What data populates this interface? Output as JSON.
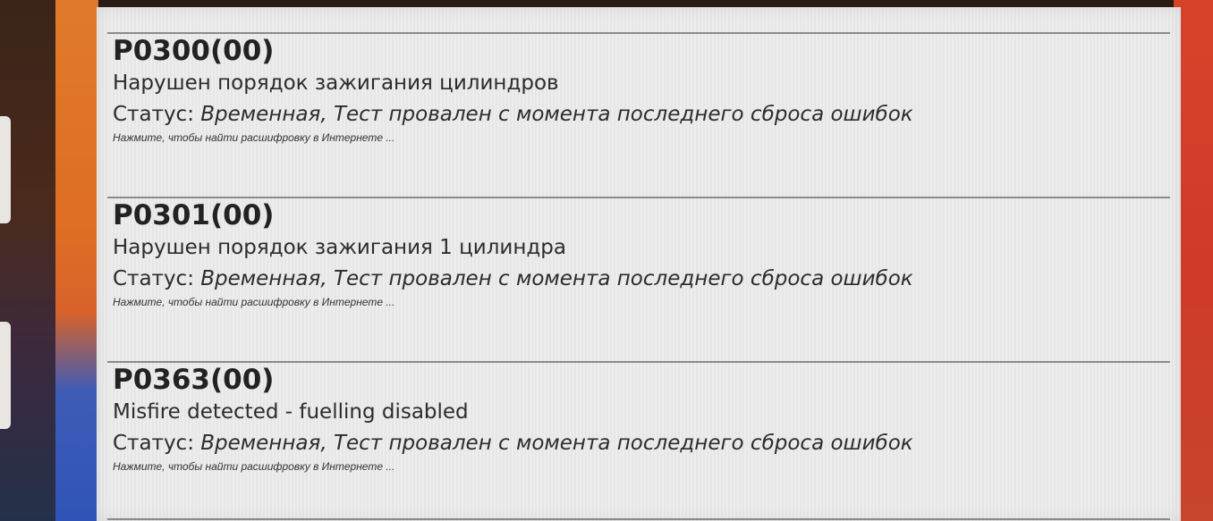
{
  "dtc_list": [
    {
      "code": "P0300(00)",
      "description": "Нарушен порядок зажигания цилиндров",
      "status_label": "Статус:",
      "status_value": "Временная, Тест провален с момента последнего сброса ошибок",
      "hint": "Нажмите, чтобы найти расшифровку в Интернете ..."
    },
    {
      "code": "P0301(00)",
      "description": "Нарушен порядок зажигания 1 цилиндра",
      "status_label": "Статус:",
      "status_value": "Временная, Тест провален с момента последнего сброса ошибок",
      "hint": "Нажмите, чтобы найти расшифровку в Интернете ..."
    },
    {
      "code": "P0363(00)",
      "description": "Misfire detected - fuelling disabled",
      "status_label": "Статус:",
      "status_value": "Временная, Тест провален с момента последнего сброса ошибок",
      "hint": "Нажмите, чтобы найти расшифровку в Интернете ..."
    }
  ]
}
